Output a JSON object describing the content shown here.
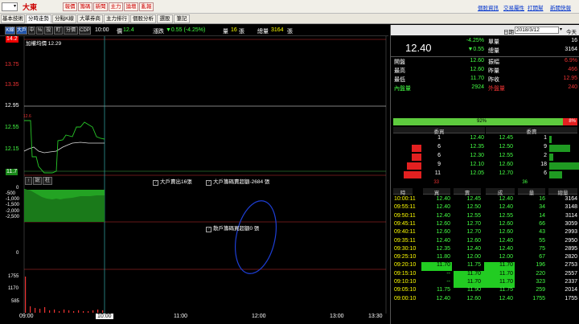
{
  "topbar": {
    "stock_select": "",
    "stock_name": "大東",
    "buttons": [
      "報價",
      "籌碼",
      "新聞",
      "主力",
      "論壇",
      "亂報"
    ],
    "links": [
      "個股資訊",
      "交易屬性",
      "打開幫",
      "新聞快報"
    ]
  },
  "tabs": [
    "基本技術",
    "分時走勢",
    "分點K線",
    "大單券商",
    "主力排行",
    "個股分析",
    "選股",
    "筆記"
  ],
  "active_tab": 1,
  "chart_toolbar": {
    "buttons": [
      "K線",
      "大戶",
      "中",
      "%",
      "投",
      "盯",
      "分價",
      "CDP"
    ],
    "on": [
      0,
      1
    ],
    "time": "10:00",
    "price_label": "價",
    "price": "12.4",
    "change_label": "漲跌",
    "change": "▼0.55 (-4.25%)",
    "vol_label": "量",
    "vol": "16",
    "vol_unit": "張",
    "total_label": "總量",
    "total": "3164",
    "total_unit": "張"
  },
  "price_panel": {
    "legend": "加權均價 12.29",
    "y_labels": [
      "14.2",
      "13.75",
      "13.35",
      "12.95",
      "12.55",
      "12.15",
      "11.7"
    ],
    "mini_label": "12.6"
  },
  "big_panel": {
    "buttons": [
      "↑",
      "說",
      "柱"
    ],
    "y_labels": [
      "0",
      "-500",
      "-1,000",
      "-1,500",
      "-2,000",
      "-2,500"
    ],
    "annotations": [
      "大戶賣出16張",
      "大戶籌碼賣超額-2684 張",
      "散戶籌碼買超額0 張"
    ]
  },
  "small_panel": {
    "y_label": "0"
  },
  "volume_panel": {
    "y_labels": [
      "1755",
      "1170",
      "585"
    ]
  },
  "time_axis": {
    "labels": [
      "09:00",
      "10:00",
      "11:00",
      "12:00",
      "13:00",
      "13:30"
    ]
  },
  "right": {
    "date_label": "日期",
    "date": "2018/3/12",
    "today": "今天",
    "price": "12.40",
    "pct": "-4.25%",
    "change": "▼0.55",
    "summary": [
      {
        "label": "單量",
        "value": "16"
      },
      {
        "label": "總量",
        "value": "3164"
      }
    ],
    "stats": [
      {
        "l1": "開盤",
        "v1": "12.60",
        "l2": "振幅",
        "v2": "6.9%"
      },
      {
        "l1": "最高",
        "v1": "12.60",
        "l2": "昨量",
        "v2": "466"
      },
      {
        "l1": "最低",
        "v1": "11.70",
        "l2": "昨收",
        "v2": "12.95"
      },
      {
        "l1": "內盤量",
        "v1": "2924",
        "l2": "外盤量",
        "v2": "240"
      }
    ],
    "ratio_left": "92%",
    "ratio_right": "8%",
    "ratio_value": 0.92,
    "ob_headers": [
      "委買",
      "委賣"
    ],
    "orderbook": [
      {
        "bq": "1",
        "bp": "12.40",
        "sp": "12.45",
        "sq": "1",
        "bw": 0,
        "sw": 3
      },
      {
        "bq": "6",
        "bp": "12.35",
        "sp": "12.50",
        "sq": "9",
        "bw": 12,
        "sw": 26
      },
      {
        "bq": "6",
        "bp": "12.30",
        "sp": "12.55",
        "sq": "2",
        "bw": 12,
        "sw": 5
      },
      {
        "bq": "9",
        "bp": "12.10",
        "sp": "12.60",
        "sq": "18",
        "bw": 18,
        "sw": 50
      },
      {
        "bq": "11",
        "bp": "12.05",
        "sp": "12.70",
        "sq": "6",
        "bw": 22,
        "sw": 16
      }
    ],
    "ob_totals": [
      "33",
      "36"
    ],
    "trade_headers": [
      "時",
      "買",
      "賣",
      "成",
      "量",
      "總量"
    ],
    "trades": [
      {
        "t": "10:00:11",
        "b": "12.40",
        "s": "12.45",
        "p": "12.40",
        "v": "16",
        "tot": "3164",
        "c": "g",
        "hl": ""
      },
      {
        "t": "09:55:11",
        "b": "12.40",
        "s": "12.50",
        "p": "12.40",
        "v": "34",
        "tot": "3148",
        "c": "g",
        "hl": ""
      },
      {
        "t": "09:50:11",
        "b": "12.40",
        "s": "12.55",
        "p": "12.55",
        "v": "14",
        "tot": "3114",
        "c": "g",
        "hl": ""
      },
      {
        "t": "09:45:11",
        "b": "12.60",
        "s": "12.70",
        "p": "12.60",
        "v": "66",
        "tot": "3059",
        "c": "g",
        "hl": ""
      },
      {
        "t": "09:40:11",
        "b": "12.60",
        "s": "12.70",
        "p": "12.60",
        "v": "43",
        "tot": "2993",
        "c": "g",
        "hl": ""
      },
      {
        "t": "09:35:11",
        "b": "12.40",
        "s": "12.60",
        "p": "12.40",
        "v": "55",
        "tot": "2950",
        "c": "g",
        "hl": ""
      },
      {
        "t": "09:30:10",
        "b": "12.35",
        "s": "12.40",
        "p": "12.40",
        "v": "75",
        "tot": "2895",
        "c": "g",
        "hl": ""
      },
      {
        "t": "09:25:10",
        "b": "11.80",
        "s": "12.00",
        "p": "12.00",
        "v": "67",
        "tot": "2820",
        "c": "g",
        "hl": ""
      },
      {
        "t": "09:20:10",
        "b": "11.70",
        "s": "11.75",
        "p": "11.70",
        "v": "196",
        "tot": "2753",
        "c": "g",
        "hl": "bp"
      },
      {
        "t": "09:15:10",
        "b": "--",
        "s": "11.70",
        "p": "11.70",
        "v": "220",
        "tot": "2557",
        "c": "g",
        "hl": "sp"
      },
      {
        "t": "09:10:10",
        "b": "--",
        "s": "11.70",
        "p": "11.70",
        "v": "323",
        "tot": "2337",
        "c": "g",
        "hl": "sp"
      },
      {
        "t": "09:05:10",
        "b": "11.75",
        "s": "11.90",
        "p": "11.75",
        "v": "259",
        "tot": "2014",
        "c": "g",
        "hl": ""
      },
      {
        "t": "09:00:10",
        "b": "12.40",
        "s": "12.60",
        "p": "12.40",
        "v": "1755",
        "tot": "1755",
        "c": "g",
        "hl": ""
      }
    ]
  }
}
